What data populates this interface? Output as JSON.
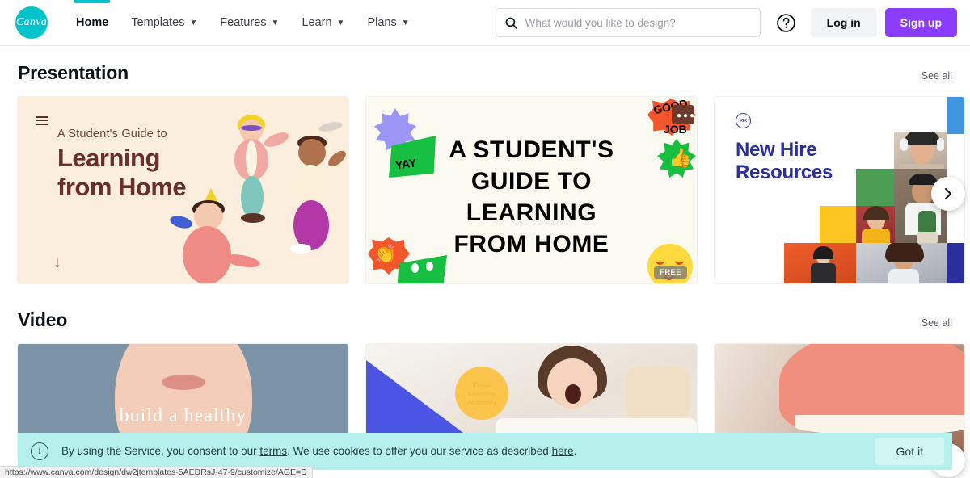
{
  "header": {
    "logo_text": "Canva",
    "nav": [
      {
        "label": "Home",
        "has_caret": false,
        "active": true
      },
      {
        "label": "Templates",
        "has_caret": true,
        "active": false
      },
      {
        "label": "Features",
        "has_caret": true,
        "active": false
      },
      {
        "label": "Learn",
        "has_caret": true,
        "active": false
      },
      {
        "label": "Plans",
        "has_caret": true,
        "active": false
      }
    ],
    "search": {
      "placeholder": "What would you like to design?",
      "value": "",
      "icon": "search-icon"
    },
    "help_icon": "question-mark-circle-icon",
    "login_label": "Log in",
    "signup_label": "Sign up",
    "accent_color": "#00c4cc",
    "signup_color": "#8b3dff"
  },
  "sections": [
    {
      "title": "Presentation",
      "see_all": "See all",
      "cards": [
        {
          "name": "learning-from-home-template",
          "subtitle": "A Student's Guide to",
          "title": "Learning\nfrom Home",
          "title_line1": "Learning",
          "title_line2": "from Home",
          "background": "#fbeedd",
          "menu_icon": "hamburger-icon",
          "scroll_icon": "arrow-down-icon"
        },
        {
          "name": "students-guide-stickers-template",
          "headline_line1": "A STUDENT'S",
          "headline_line2": "GUIDE TO",
          "headline_line3": "LEARNING",
          "headline_line4": "FROM HOME",
          "background": "#fbfaf0",
          "badge": "FREE",
          "stickers": [
            "YAY",
            "GOOD",
            "JOB"
          ]
        },
        {
          "name": "new-hire-resources-template",
          "logo_mark": "KIK",
          "title_line1": "New Hire",
          "title_line2": "Resources",
          "background": "#ffffff",
          "title_color": "#2b2f9e"
        }
      ]
    },
    {
      "title": "Video",
      "see_all": "See all",
      "cards": [
        {
          "name": "video-card-portrait",
          "overlay_text": "build a healthy",
          "background": "#7c93a8"
        },
        {
          "name": "video-card-kid",
          "circle_line1": "Visual",
          "circle_line2": "Learning",
          "circle_line3": "Academy",
          "background": "#f3f0ec"
        },
        {
          "name": "video-card-food",
          "background": "#e8dcd2"
        }
      ]
    }
  ],
  "carousel": {
    "next_icon": "chevron-right-icon",
    "presentation_label": "›",
    "video_label": "›"
  },
  "cookie_banner": {
    "icon": "info-icon",
    "text_part1": "By using the Service, you consent to our ",
    "link1": "terms",
    "text_part2": ". We use cookies to offer you our service as described ",
    "link2": "here",
    "text_part3": ".",
    "button_label": "Got it",
    "background": "#b6f0ec"
  },
  "status_bar": {
    "url": "https://www.canva.com/design/dw2jtemplates-5AEDRsJ-47-9/customize/AGE=D"
  }
}
